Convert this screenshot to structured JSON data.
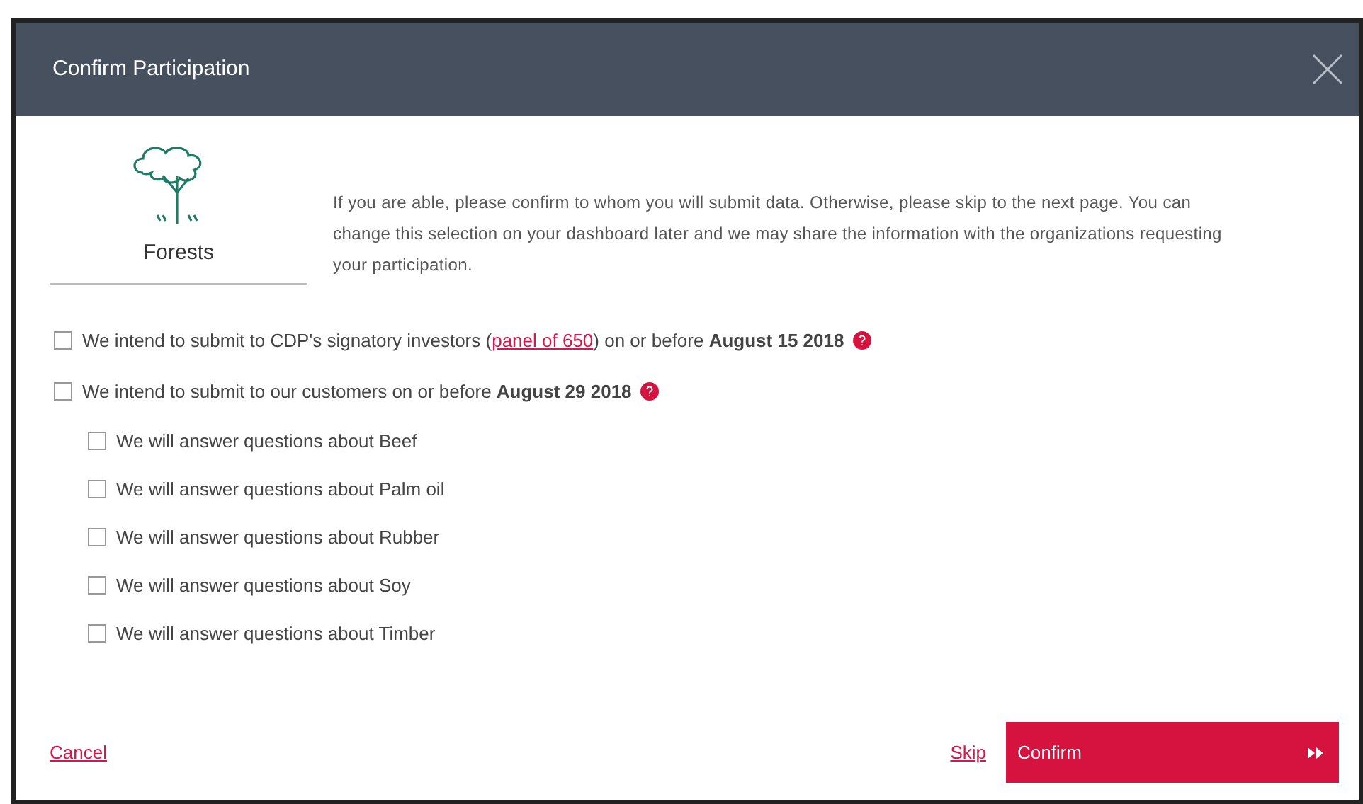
{
  "dialog": {
    "title": "Confirm Participation"
  },
  "topic": {
    "label": "Forests"
  },
  "intro": "If you are able, please confirm to whom you will submit data. Otherwise, please skip to the next page. You can change this selection on your dashboard later and we may share the information with the organizations requesting your participation.",
  "options": [
    {
      "text_before": "We intend to submit to CDP's signatory investors (",
      "link": "panel of 650",
      "text_after": ") on or before **August 15 2018**",
      "checked": false,
      "help": true
    },
    {
      "text_before": "We intend to submit to our customers on or before **August 29 2018**",
      "checked": false,
      "help": true,
      "children": [
        {
          "text_before": "We will answer questions about Beef",
          "checked": false
        },
        {
          "text_before": "We will answer questions about Palm oil",
          "checked": false
        },
        {
          "text_before": "We will answer questions about Rubber",
          "checked": false
        },
        {
          "text_before": "We will answer questions about Soy",
          "checked": false
        },
        {
          "text_before": "We will answer questions about Timber",
          "checked": false
        }
      ]
    }
  ],
  "footer": {
    "cancel": "Cancel",
    "skip": "Skip",
    "confirm": "Confirm"
  }
}
